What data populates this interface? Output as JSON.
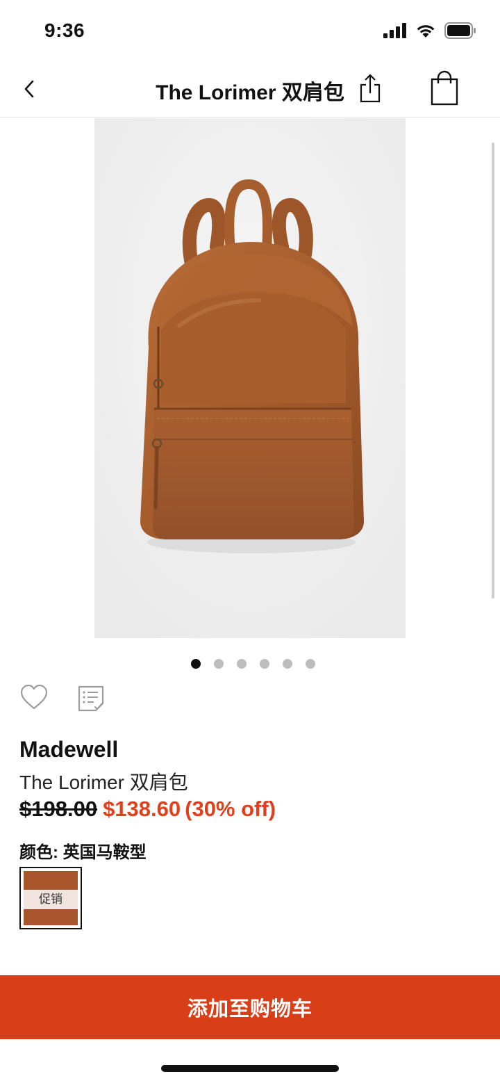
{
  "status_bar": {
    "time": "9:36"
  },
  "nav": {
    "title": "The Lorimer 双肩包"
  },
  "gallery": {
    "image_count": 6,
    "active_index": 0
  },
  "product": {
    "brand": "Madewell",
    "name": "The Lorimer 双肩包",
    "price_original": "$198.00",
    "price_sale": "$138.60",
    "discount": "(30% off)",
    "color_label": "颜色: 英国马鞍型",
    "swatch_badge": "促销"
  },
  "cart": {
    "button_label": "添加至购物车"
  },
  "colors": {
    "accent": "#d83f19",
    "sale_price": "#e0401c",
    "swatch": "#a9552c",
    "leather": "#a8602f"
  }
}
